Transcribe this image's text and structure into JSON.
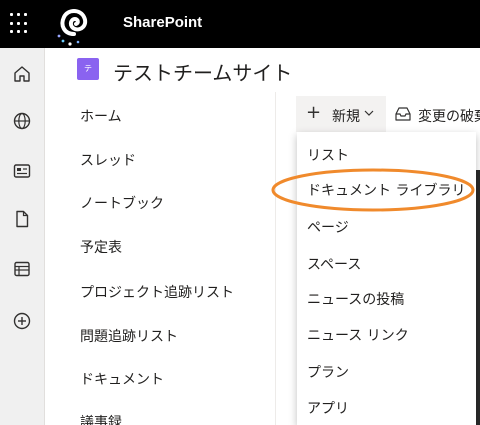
{
  "app": {
    "title": "SharePoint"
  },
  "site": {
    "badge": "テ",
    "title": "テストチームサイト"
  },
  "rail": {
    "icons": [
      "home-icon",
      "globe-icon",
      "news-icon",
      "file-icon",
      "list-icon",
      "add-icon"
    ]
  },
  "leftnav": {
    "items": [
      {
        "label": "ホーム"
      },
      {
        "label": "スレッド"
      },
      {
        "label": "ノートブック"
      },
      {
        "label": "予定表"
      },
      {
        "label": "プロジェクト追跡リスト"
      },
      {
        "label": "問題追跡リスト"
      },
      {
        "label": "ドキュメント"
      },
      {
        "label": "議事録"
      }
    ]
  },
  "commandbar": {
    "new_label": "新規",
    "discard_label": "変更の破棄"
  },
  "new_menu": {
    "items": [
      {
        "label": "リスト"
      },
      {
        "label": "ドキュメント ライブラリ"
      },
      {
        "label": "ページ"
      },
      {
        "label": "スペース"
      },
      {
        "label": "ニュースの投稿"
      },
      {
        "label": "ニュース リンク"
      },
      {
        "label": "プラン"
      },
      {
        "label": "アプリ"
      }
    ],
    "highlighted_index": 1
  },
  "colors": {
    "topbar": "#000000",
    "site_badge": "#8a63f0",
    "highlight": "#f08a2c"
  }
}
